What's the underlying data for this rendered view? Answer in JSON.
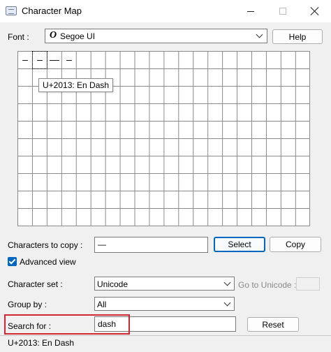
{
  "window": {
    "title": "Character Map"
  },
  "font": {
    "label": "Font :",
    "value": "Segoe UI",
    "icon": "opentype-font-icon"
  },
  "help_label": "Help",
  "grid": {
    "visible_chars": [
      "–",
      "–",
      "—",
      "–"
    ],
    "selected_index": 1
  },
  "tooltip": "U+2013: En Dash",
  "copy": {
    "label": "Characters to copy :",
    "value": "—",
    "select_label": "Select",
    "copy_label": "Copy"
  },
  "advanced": {
    "label": "Advanced view",
    "checked": true
  },
  "charset": {
    "label": "Character set :",
    "value": "Unicode",
    "goto_label": "Go to Unicode :"
  },
  "groupby": {
    "label": "Group by :",
    "value": "All"
  },
  "search": {
    "label": "Search for :",
    "value": "dash",
    "reset_label": "Reset"
  },
  "status": "U+2013: En Dash",
  "colors": {
    "accent": "#0067c0",
    "highlight": "#d22630"
  }
}
